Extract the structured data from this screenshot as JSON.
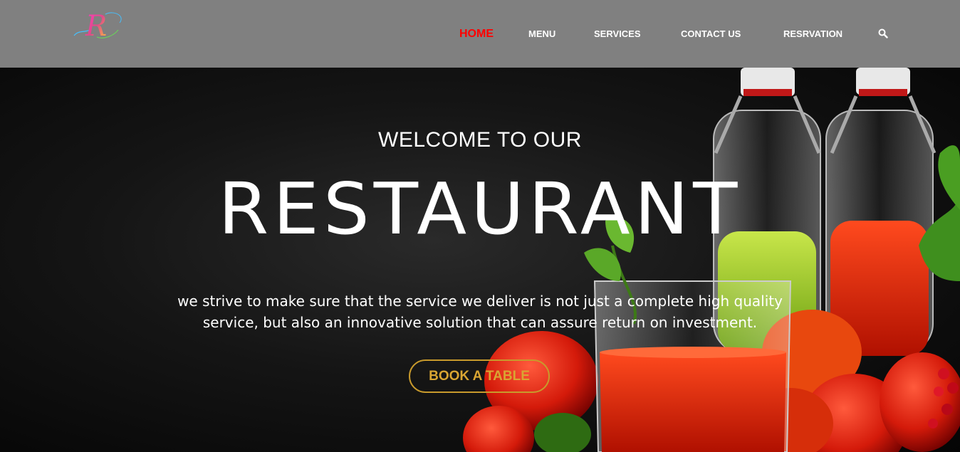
{
  "header": {
    "logo_letter": "R",
    "nav": [
      {
        "label": "HOME",
        "active": true
      },
      {
        "label": "MENU",
        "active": false
      },
      {
        "label": "SERVICES",
        "active": false
      },
      {
        "label": "CONTACT US",
        "active": false
      },
      {
        "label": "RESRVATION",
        "active": false
      }
    ],
    "search_icon": "search-icon"
  },
  "hero": {
    "welcome": "WELCOME TO OUR",
    "title": "RESTAURANT",
    "tagline_line1": "we strive to make sure that the service we deliver is not just a complete high quality",
    "tagline_line2": "service, but also an innovative solution that can assure return on investment.",
    "cta": "BOOK A TABLE"
  },
  "colors": {
    "header_bg": "#808080",
    "nav_active": "#ff0000",
    "cta_accent": "#d9a532"
  }
}
